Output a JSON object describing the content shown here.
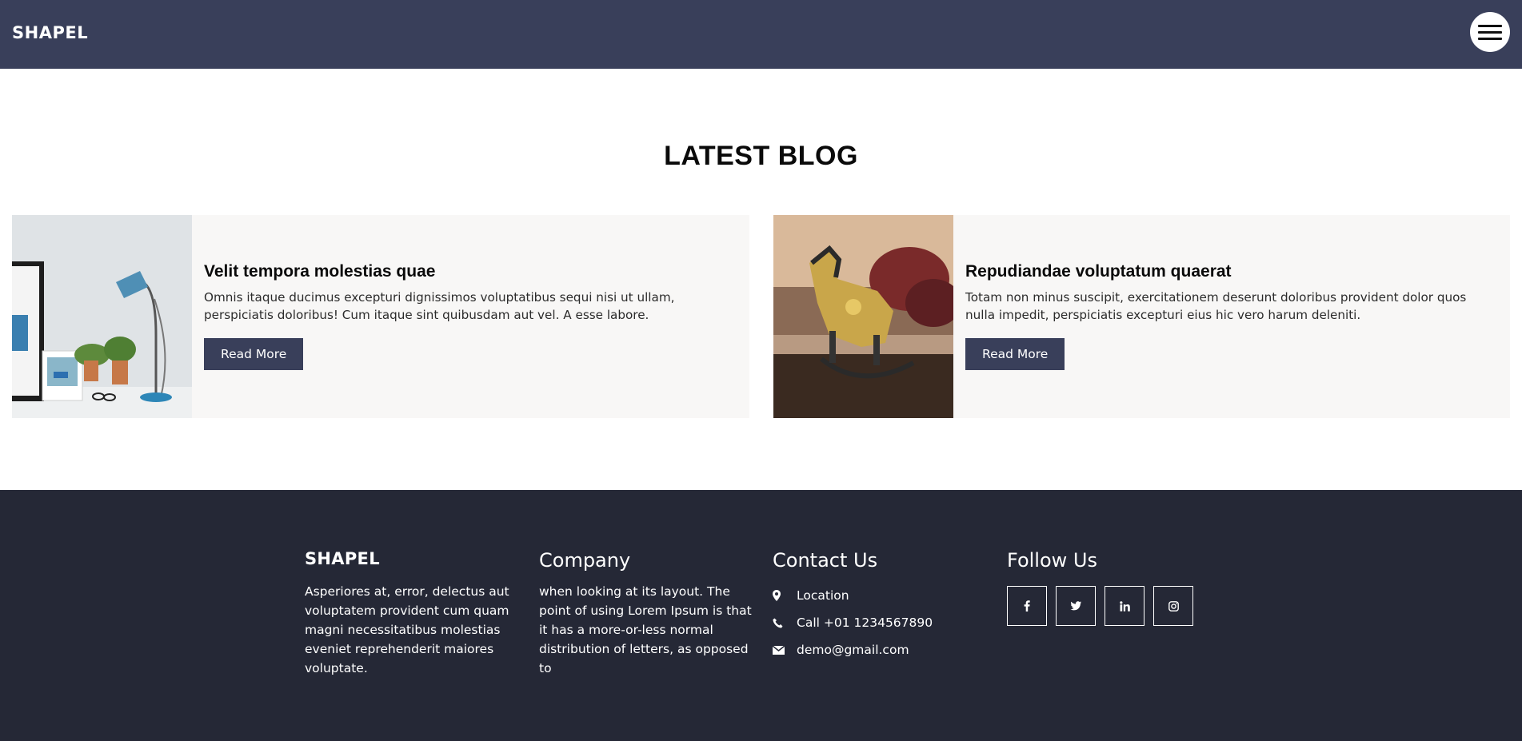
{
  "header": {
    "logo": "SHAPEL",
    "menu_icon": "hamburger-menu-icon",
    "bg_color": "#393f5a"
  },
  "blog": {
    "title": "LATEST BLOG",
    "posts": [
      {
        "title": "Velit tempora molestias quae",
        "text": "Omnis itaque ducimus excepturi dignissimos voluptatibus sequi nisi ut ullam, perspiciatis doloribus! Cum itaque sint quibusdam aut vel. A esse labore.",
        "button": "Read More",
        "image": "desk-lamp-plants-photo"
      },
      {
        "title": "Repudiandae voluptatum quaerat",
        "text": "Totam non minus suscipit, exercitationem deserunt doloribus provident dolor quos nulla impedit, perspiciatis excepturi eius hic vero harum deleniti.",
        "button": "Read More",
        "image": "rocking-horse-figurine-photo"
      }
    ]
  },
  "footer": {
    "brand": "SHAPEL",
    "about": "Asperiores at, error, delectus aut voluptatem provident cum quam magni necessitatibus molestias eveniet reprehenderit maiores voluptate.",
    "company_heading": "Company",
    "company_text": "when looking at its layout. The point of using Lorem Ipsum is that it has a more-or-less normal distribution of letters, as opposed to",
    "contact_heading": "Contact Us",
    "contact": {
      "location": "Location",
      "phone": "Call +01 1234567890",
      "email": "demo@gmail.com"
    },
    "follow_heading": "Follow Us",
    "social": [
      "facebook-icon",
      "twitter-icon",
      "linkedin-icon",
      "instagram-icon"
    ],
    "bg_color": "#252836"
  }
}
